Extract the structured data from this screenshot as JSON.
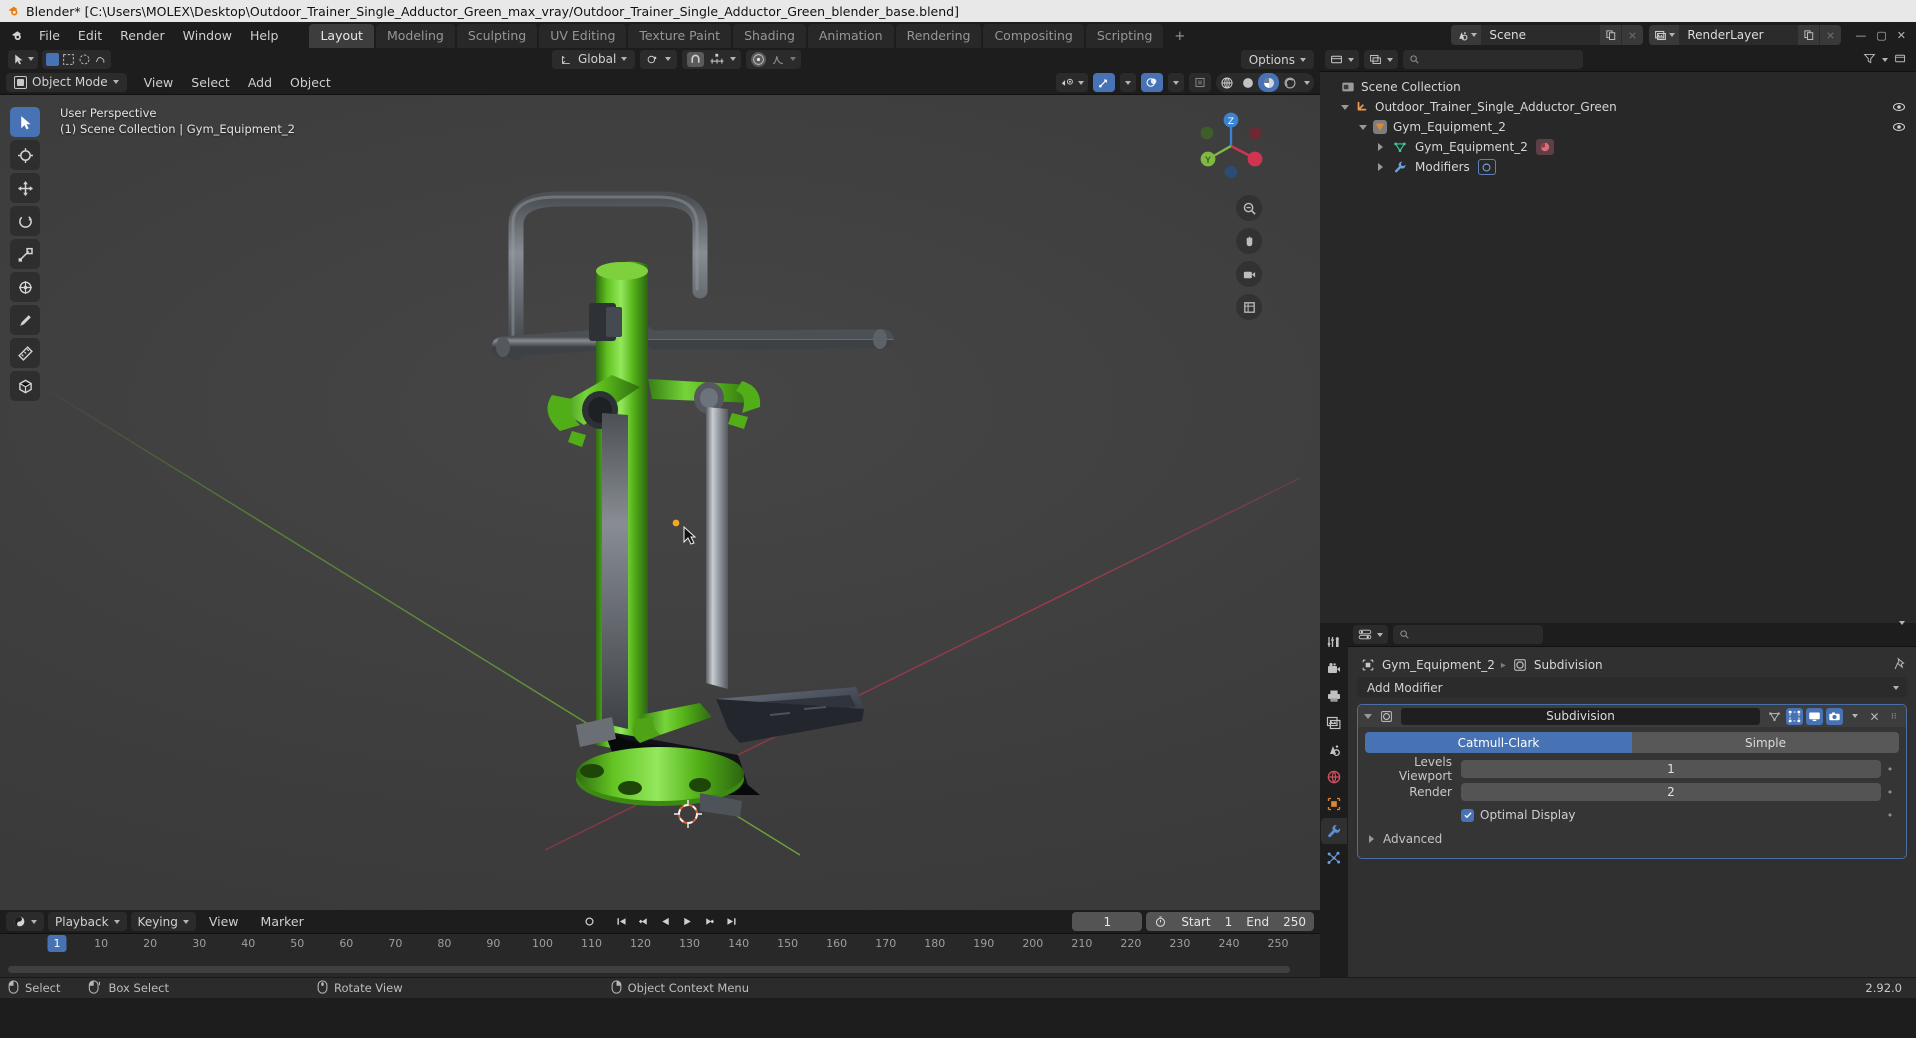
{
  "window": {
    "title": "Blender* [C:\\Users\\MOLEX\\Desktop\\Outdoor_Trainer_Single_Adductor_Green_max_vray/Outdoor_Trainer_Single_Adductor_Green_blender_base.blend]",
    "app_icon": "blender-logo-icon",
    "minimize": "—",
    "maximize": "▢",
    "close": "✕"
  },
  "topbar": {
    "menus": [
      "File",
      "Edit",
      "Render",
      "Window",
      "Help"
    ],
    "workspaces": [
      {
        "label": "Layout",
        "active": true
      },
      {
        "label": "Modeling",
        "active": false
      },
      {
        "label": "Sculpting",
        "active": false
      },
      {
        "label": "UV Editing",
        "active": false
      },
      {
        "label": "Texture Paint",
        "active": false
      },
      {
        "label": "Shading",
        "active": false
      },
      {
        "label": "Animation",
        "active": false
      },
      {
        "label": "Rendering",
        "active": false
      },
      {
        "label": "Compositing",
        "active": false
      },
      {
        "label": "Scripting",
        "active": false
      }
    ],
    "add_workspace": "+",
    "scene": {
      "name": "Scene",
      "icon": "scene-icon"
    },
    "view_layer": {
      "name": "RenderLayer",
      "icon": "view-layer-icon"
    }
  },
  "viewport_header": {
    "mode": "Object Mode",
    "mode_icon": "object-mode-icon",
    "menus": [
      "View",
      "Select",
      "Add",
      "Object"
    ],
    "transform_orientation": "Global",
    "snap_icon": "magnet-icon",
    "proportional_icon": "proportional-edit-icon",
    "overlay_icons": [
      "visibility-icon",
      "gizmo-icon",
      "overlays-icon",
      "xray-icon"
    ],
    "shading_modes": [
      "wireframe",
      "solid",
      "material-preview",
      "rendered"
    ],
    "shading_selected": "material-preview",
    "options_label": "Options"
  },
  "viewport": {
    "perspective": "User Perspective",
    "context": "(1) Scene Collection | Gym_Equipment_2",
    "gizmo_axes": [
      {
        "label": "X",
        "color": "#d0344f"
      },
      {
        "label": "Y",
        "color": "#80c42a"
      },
      {
        "label": "Z",
        "color": "#3b83d1"
      }
    ],
    "nav_buttons": [
      "zoom-icon",
      "pan-hand-icon",
      "camera-icon",
      "orthographic-icon"
    ],
    "tools": [
      {
        "name": "tweak-select-tool",
        "active": true
      },
      {
        "name": "cursor-tool",
        "active": false
      },
      {
        "name": "move-tool",
        "active": false
      },
      {
        "name": "rotate-tool",
        "active": false
      },
      {
        "name": "scale-tool",
        "active": false
      },
      {
        "name": "transform-tool",
        "active": false
      },
      {
        "name": "annotate-tool",
        "active": false
      },
      {
        "name": "measure-tool",
        "active": false
      },
      {
        "name": "add-cube-tool",
        "active": false
      }
    ]
  },
  "outliner": {
    "display_mode_icon": "view-layer-icon",
    "filter_icon": "filter-icon",
    "search_placeholder": "",
    "rows": [
      {
        "indent": 0,
        "label": "Scene Collection",
        "icon": "collection-icon",
        "expander": "none",
        "eye": false
      },
      {
        "indent": 1,
        "label": "Outdoor_Trainer_Single_Adductor_Green",
        "icon": "empty-axis-icon",
        "expander": "open",
        "eye": true
      },
      {
        "indent": 2,
        "label": "Gym_Equipment_2",
        "icon": "mesh-object-icon",
        "expander": "open",
        "eye": true
      },
      {
        "indent": 3,
        "label": "Gym_Equipment_2",
        "icon": "mesh-data-icon",
        "expander": "closed",
        "eye": false,
        "badge": "material-icon"
      },
      {
        "indent": 3,
        "label": "Modifiers",
        "icon": "wrench-icon",
        "expander": "closed",
        "eye": false,
        "badge": "subdivision-icon"
      }
    ]
  },
  "properties": {
    "tabs": [
      {
        "name": "tool-tab",
        "icon": "tool-icon",
        "selected": false
      },
      {
        "name": "render-tab",
        "icon": "render-camera-icon",
        "selected": false
      },
      {
        "name": "output-tab",
        "icon": "printer-icon",
        "selected": false
      },
      {
        "name": "view-layer-tab",
        "icon": "images-icon",
        "selected": false
      },
      {
        "name": "scene-tab",
        "icon": "scene-cone-icon",
        "selected": false
      },
      {
        "name": "world-tab",
        "icon": "world-globe-icon",
        "selected": false
      },
      {
        "name": "object-tab",
        "icon": "object-square-icon",
        "selected": false
      },
      {
        "name": "modifier-tab",
        "icon": "wrench-icon",
        "selected": true
      },
      {
        "name": "particles-tab",
        "icon": "particles-icon",
        "selected": false
      }
    ],
    "editor_icon": "properties-editor-icon",
    "search_placeholder": "",
    "breadcrumb": [
      {
        "label": "Gym_Equipment_2",
        "icon": "object-icon"
      },
      {
        "label": "Subdivision",
        "icon": "modifier-icon"
      }
    ],
    "pin_icon": "pin-icon",
    "add_modifier": "Add Modifier",
    "modifier": {
      "icon": "subdivision-icon",
      "name": "Subdivision",
      "toggles": [
        {
          "name": "on-cage-toggle",
          "icon": "cage-icon",
          "on": false
        },
        {
          "name": "edit-mode-toggle",
          "icon": "edit-mode-icon",
          "on": true
        },
        {
          "name": "realtime-toggle",
          "icon": "display-icon",
          "on": true
        },
        {
          "name": "render-toggle",
          "icon": "camera-icon",
          "on": true
        }
      ],
      "dropdown_icon": "chevron-down-icon",
      "close_icon": "x-icon",
      "grip_icon": "grip-dots-icon",
      "algorithm": {
        "options": [
          "Catmull-Clark",
          "Simple"
        ],
        "selected": "Catmull-Clark"
      },
      "levels_viewport_label": "Levels Viewport",
      "levels_viewport_value": "1",
      "render_label": "Render",
      "render_value": "2",
      "optimal_display_label": "Optimal Display",
      "optimal_display_checked": true,
      "advanced_label": "Advanced"
    }
  },
  "timeline": {
    "editor_icon": "timeline-editor-icon",
    "menus": [
      {
        "label": "Playback",
        "dropdown": true
      },
      {
        "label": "Keying",
        "dropdown": true
      },
      {
        "label": "View",
        "dropdown": false
      },
      {
        "label": "Marker",
        "dropdown": false
      }
    ],
    "playback_controls": [
      "record-icon",
      "jump-start-icon",
      "prev-keyframe-icon",
      "play-reverse-icon",
      "play-icon",
      "next-keyframe-icon",
      "jump-end-icon"
    ],
    "current_frame": "1",
    "timer_icon": "stopwatch-icon",
    "start_label": "Start",
    "start_value": "1",
    "end_label": "End",
    "end_value": "250",
    "ticks": [
      1,
      10,
      20,
      30,
      40,
      50,
      60,
      70,
      80,
      90,
      100,
      110,
      120,
      130,
      140,
      150,
      160,
      170,
      180,
      190,
      200,
      210,
      220,
      230,
      240,
      250
    ],
    "playhead_frame": "1"
  },
  "status_bar": {
    "items": [
      {
        "icon": "mouse-left-icon",
        "label": "Select"
      },
      {
        "icon": "mouse-drag-icon",
        "label": "Box Select"
      },
      {
        "icon": "mouse-middle-icon",
        "label": "Rotate View"
      },
      {
        "icon": "mouse-right-icon",
        "label": "Object Context Menu"
      }
    ],
    "version": "2.92.0"
  },
  "colors": {
    "accent_blue": "#4772b3",
    "bg_dark": "#1d1d1d",
    "bg_panel": "#303030",
    "bg_outliner": "#282828",
    "viewport_bg": "#3d3d3d",
    "axis_x": "#d0344f",
    "axis_y": "#7aa548",
    "model_green": "#5bbe1f",
    "model_metal": "#6b6e72"
  }
}
